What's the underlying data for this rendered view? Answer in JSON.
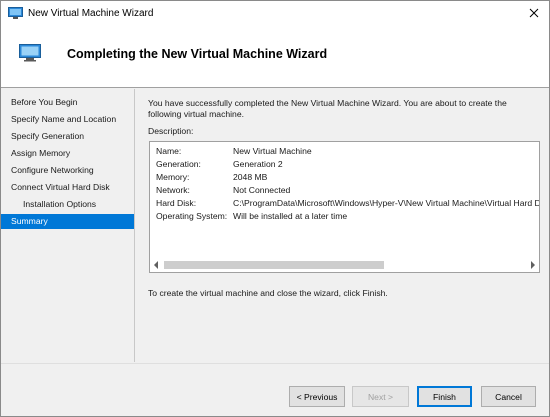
{
  "window": {
    "title": "New Virtual Machine Wizard"
  },
  "header": {
    "title": "Completing the New Virtual Machine Wizard"
  },
  "nav": {
    "items": [
      {
        "label": "Before You Begin"
      },
      {
        "label": "Specify Name and Location"
      },
      {
        "label": "Specify Generation"
      },
      {
        "label": "Assign Memory"
      },
      {
        "label": "Configure Networking"
      },
      {
        "label": "Connect Virtual Hard Disk"
      },
      {
        "label": "Installation Options"
      },
      {
        "label": "Summary"
      }
    ],
    "selected_index": 7
  },
  "main": {
    "intro_line1": "You have successfully completed the New Virtual Machine Wizard. You are about to create the",
    "intro_line2": "following virtual machine.",
    "description_label": "Description:",
    "rows": [
      {
        "key": "Name:",
        "value": "New Virtual Machine"
      },
      {
        "key": "Generation:",
        "value": "Generation 2"
      },
      {
        "key": "Memory:",
        "value": "2048 MB"
      },
      {
        "key": "Network:",
        "value": "Not Connected"
      },
      {
        "key": "Hard Disk:",
        "value": "C:\\ProgramData\\Microsoft\\Windows\\Hyper-V\\New Virtual Machine\\Virtual Hard Di"
      },
      {
        "key": "Operating System:",
        "value": "Will be installed at a later time"
      }
    ],
    "finish_note": "To create the virtual machine and close the wizard, click Finish."
  },
  "buttons": {
    "previous": "< Previous",
    "next": "Next >",
    "finish": "Finish",
    "cancel": "Cancel"
  },
  "colors": {
    "accent": "#0078d7",
    "window_bg": "#f0f0f0"
  }
}
